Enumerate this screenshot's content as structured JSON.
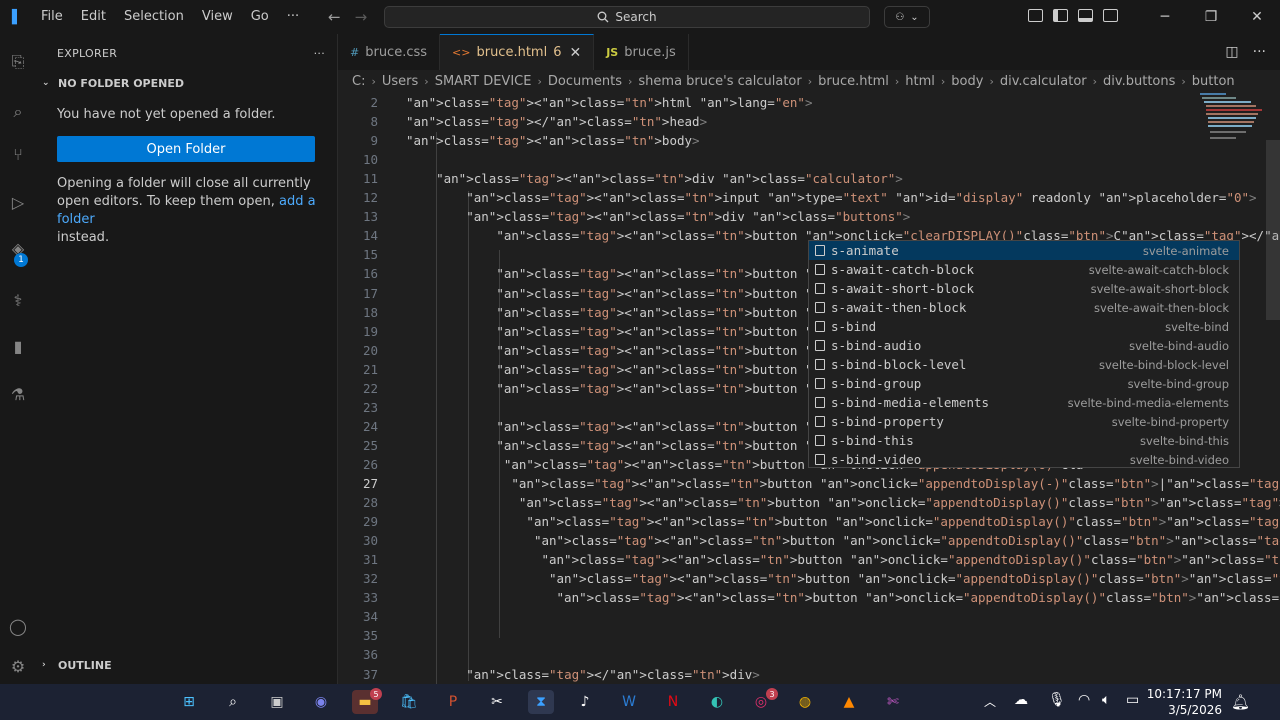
{
  "menu": [
    "File",
    "Edit",
    "Selection",
    "View",
    "Go",
    "···"
  ],
  "search": {
    "label": "Search"
  },
  "explorer": {
    "title": "EXPLORER",
    "more": "···",
    "section": "NO FOLDER OPENED",
    "message": "You have not yet opened a folder.",
    "open_button": "Open Folder",
    "note_before": "Opening a folder will close all currently open editors. To keep them open, ",
    "note_link": "add a folder",
    "note_after": "instead.",
    "outline": "OUTLINE"
  },
  "activity_badge": "1",
  "tabs": [
    {
      "icon": "#",
      "label": "bruce.css",
      "active": false
    },
    {
      "icon": "<>",
      "label": "bruce.html",
      "modified": "6",
      "active": true
    },
    {
      "icon": "JS",
      "label": "bruce.js",
      "active": false
    }
  ],
  "breadcrumb": [
    "C:",
    "Users",
    "SMART DEVICE",
    "Documents",
    "shema bruce's calculator",
    "bruce.html",
    "html",
    "body",
    "div.calculator",
    "div.buttons",
    "button"
  ],
  "code_lines": [
    {
      "n": "2",
      "text": "<html lang=\"en\">"
    },
    {
      "n": "8",
      "text": "</head>"
    },
    {
      "n": "9",
      "text": "<body>"
    },
    {
      "n": "10",
      "text": ""
    },
    {
      "n": "11",
      "text": "    <div class=\"calculator\">"
    },
    {
      "n": "12",
      "text": "        <input type=\"text\" id=\"display\" readonly placeholder=\"0\">"
    },
    {
      "n": "13",
      "text": "        <div class=\"buttons\">"
    },
    {
      "n": "14",
      "text": "            <button onclick=\"clearDISPLAY()\"class=\"btn\">C</button>"
    },
    {
      "n": "15",
      "text": ""
    },
    {
      "n": "16",
      "text": "            <button onclick=\"DeleteLast()\"class=\"btn\""
    },
    {
      "n": "17",
      "text": "            <button onclick=\"appendtoDisplay(%)\"class"
    },
    {
      "n": "18",
      "text": "            <button onclick=\"appendtoDisplay(/)\"class"
    },
    {
      "n": "19",
      "text": "            <button onclick=\"appendtoDisplay(7)\"class"
    },
    {
      "n": "20",
      "text": "            <button onclick=\"appendtoDisplay(8)\"class"
    },
    {
      "n": "21",
      "text": "            <button onclick=\"appendtoDisplay(9)\"class"
    },
    {
      "n": "22",
      "text": "            <button onclick=\"appendtoDisplay(*)\"class"
    },
    {
      "n": "23",
      "text": ""
    },
    {
      "n": "24",
      "text": "            <button onclick=\"appendtoDisplay(4)\"class"
    },
    {
      "n": "25",
      "text": "            <button onclick=\"appendtoDisplay(5)\"class"
    },
    {
      "n": "26",
      "text": "             <button onclick=\"appendtoDisplay(6)\"cla"
    },
    {
      "n": "27",
      "text": "              <button onclick=\"appendtoDisplay(-)\"class=\"btn\">|</button>"
    },
    {
      "n": "28",
      "text": "               <button onclick=\"appendtoDisplay()\"class=\"btn\"></button>"
    },
    {
      "n": "29",
      "text": "                <button onclick=\"appendtoDisplay()\"class=\"btn\"></button>"
    },
    {
      "n": "30",
      "text": "                 <button onclick=\"appendtoDisplay()\"class=\"btn\"></button>"
    },
    {
      "n": "31",
      "text": "                  <button onclick=\"appendtoDisplay()\"class=\"btn\"></button>"
    },
    {
      "n": "32",
      "text": "                   <button onclick=\"appendtoDisplay()\"class=\"btn\"></button>"
    },
    {
      "n": "33",
      "text": "                    <button onclick=\"appendtoDisplay()\"class=\"btn\"></button>"
    },
    {
      "n": "34",
      "text": ""
    },
    {
      "n": "35",
      "text": ""
    },
    {
      "n": "36",
      "text": ""
    },
    {
      "n": "37",
      "text": "        </div>"
    }
  ],
  "current_line": "27",
  "suggestions": [
    {
      "label": "s-animate",
      "detail": "svelte-animate"
    },
    {
      "label": "s-await-catch-block",
      "detail": "svelte-await-catch-block"
    },
    {
      "label": "s-await-short-block",
      "detail": "svelte-await-short-block"
    },
    {
      "label": "s-await-then-block",
      "detail": "svelte-await-then-block"
    },
    {
      "label": "s-bind",
      "detail": "svelte-bind"
    },
    {
      "label": "s-bind-audio",
      "detail": "svelte-bind-audio"
    },
    {
      "label": "s-bind-block-level",
      "detail": "svelte-bind-block-level"
    },
    {
      "label": "s-bind-group",
      "detail": "svelte-bind-group"
    },
    {
      "label": "s-bind-media-elements",
      "detail": "svelte-bind-media-elements"
    },
    {
      "label": "s-bind-property",
      "detail": "svelte-bind-property"
    },
    {
      "label": "s-bind-this",
      "detail": "svelte-bind-this"
    },
    {
      "label": "s-bind-video",
      "detail": "svelte-bind-video"
    }
  ],
  "taskbar": {
    "apps": [
      "start-icon",
      "search-icon",
      "task-view-icon",
      "teams-icon",
      "file-explorer-icon",
      "store-icon",
      "powerpoint-icon",
      "capcut-icon",
      "vscode-icon",
      "tiktok-icon",
      "word-icon",
      "netflix-icon",
      "edge-icon",
      "instagram-icon",
      "chrome-icon",
      "vlc-icon",
      "snipping-tool-icon"
    ],
    "badges": {
      "file-explorer-icon": "5",
      "instagram-icon": "3"
    },
    "time": "10:17:17 PM",
    "date": "3/5/2026"
  },
  "colors": {
    "accent": "#0078d4",
    "modified": "#e2c08d",
    "tag": "#569cd6",
    "attr": "#9cdcfe",
    "string": "#ce9178"
  }
}
